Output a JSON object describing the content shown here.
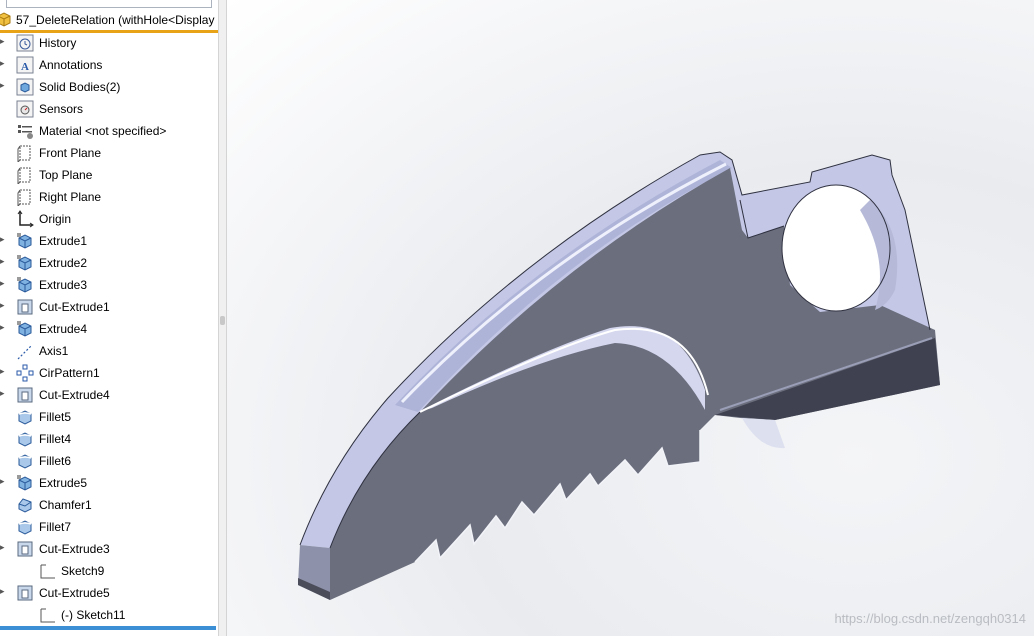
{
  "tree": {
    "root_label": "57_DeleteRelation  (withHole<Display",
    "items": [
      {
        "label": "History",
        "icon": "history-icon",
        "expand": true
      },
      {
        "label": "Annotations",
        "icon": "annotations-icon",
        "expand": true
      },
      {
        "label": "Solid Bodies(2)",
        "icon": "solid-bodies-icon",
        "expand": true
      },
      {
        "label": "Sensors",
        "icon": "sensors-icon",
        "expand": false
      },
      {
        "label": "Material <not specified>",
        "icon": "material-icon",
        "expand": false
      },
      {
        "label": "Front Plane",
        "icon": "plane-icon",
        "expand": false
      },
      {
        "label": "Top Plane",
        "icon": "plane-icon",
        "expand": false
      },
      {
        "label": "Right Plane",
        "icon": "plane-icon",
        "expand": false
      },
      {
        "label": "Origin",
        "icon": "origin-icon",
        "expand": false
      },
      {
        "label": "Extrude1",
        "icon": "extrude-icon",
        "expand": true
      },
      {
        "label": "Extrude2",
        "icon": "extrude-icon",
        "expand": true
      },
      {
        "label": "Extrude3",
        "icon": "extrude-icon",
        "expand": true
      },
      {
        "label": "Cut-Extrude1",
        "icon": "cut-extrude-icon",
        "expand": true
      },
      {
        "label": "Extrude4",
        "icon": "extrude-icon",
        "expand": true
      },
      {
        "label": "Axis1",
        "icon": "axis-icon",
        "expand": false
      },
      {
        "label": "CirPattern1",
        "icon": "circular-pattern-icon",
        "expand": true
      },
      {
        "label": "Cut-Extrude4",
        "icon": "cut-extrude-icon",
        "expand": true
      },
      {
        "label": "Fillet5",
        "icon": "fillet-icon",
        "expand": false
      },
      {
        "label": "Fillet4",
        "icon": "fillet-icon",
        "expand": false
      },
      {
        "label": "Fillet6",
        "icon": "fillet-icon",
        "expand": false
      },
      {
        "label": "Extrude5",
        "icon": "extrude-icon",
        "expand": true
      },
      {
        "label": "Chamfer1",
        "icon": "chamfer-icon",
        "expand": false
      },
      {
        "label": "Fillet7",
        "icon": "fillet-icon",
        "expand": false
      },
      {
        "label": "Cut-Extrude3",
        "icon": "cut-extrude-icon",
        "expand": true
      },
      {
        "label": "Sketch9",
        "icon": "sketch-icon",
        "expand": false,
        "child": true
      },
      {
        "label": "Cut-Extrude5",
        "icon": "cut-extrude-icon",
        "expand": true
      },
      {
        "label": "(-) Sketch11",
        "icon": "sketch-icon",
        "expand": false,
        "child": true
      }
    ]
  },
  "viewport": {
    "watermark": "https://blog.csdn.net/zengqh0314"
  },
  "colors": {
    "accent_orange": "#e8a317",
    "accent_blue": "#3c8fd4",
    "part_face": "#6b6e7d",
    "part_light": "#c4c8e6"
  }
}
